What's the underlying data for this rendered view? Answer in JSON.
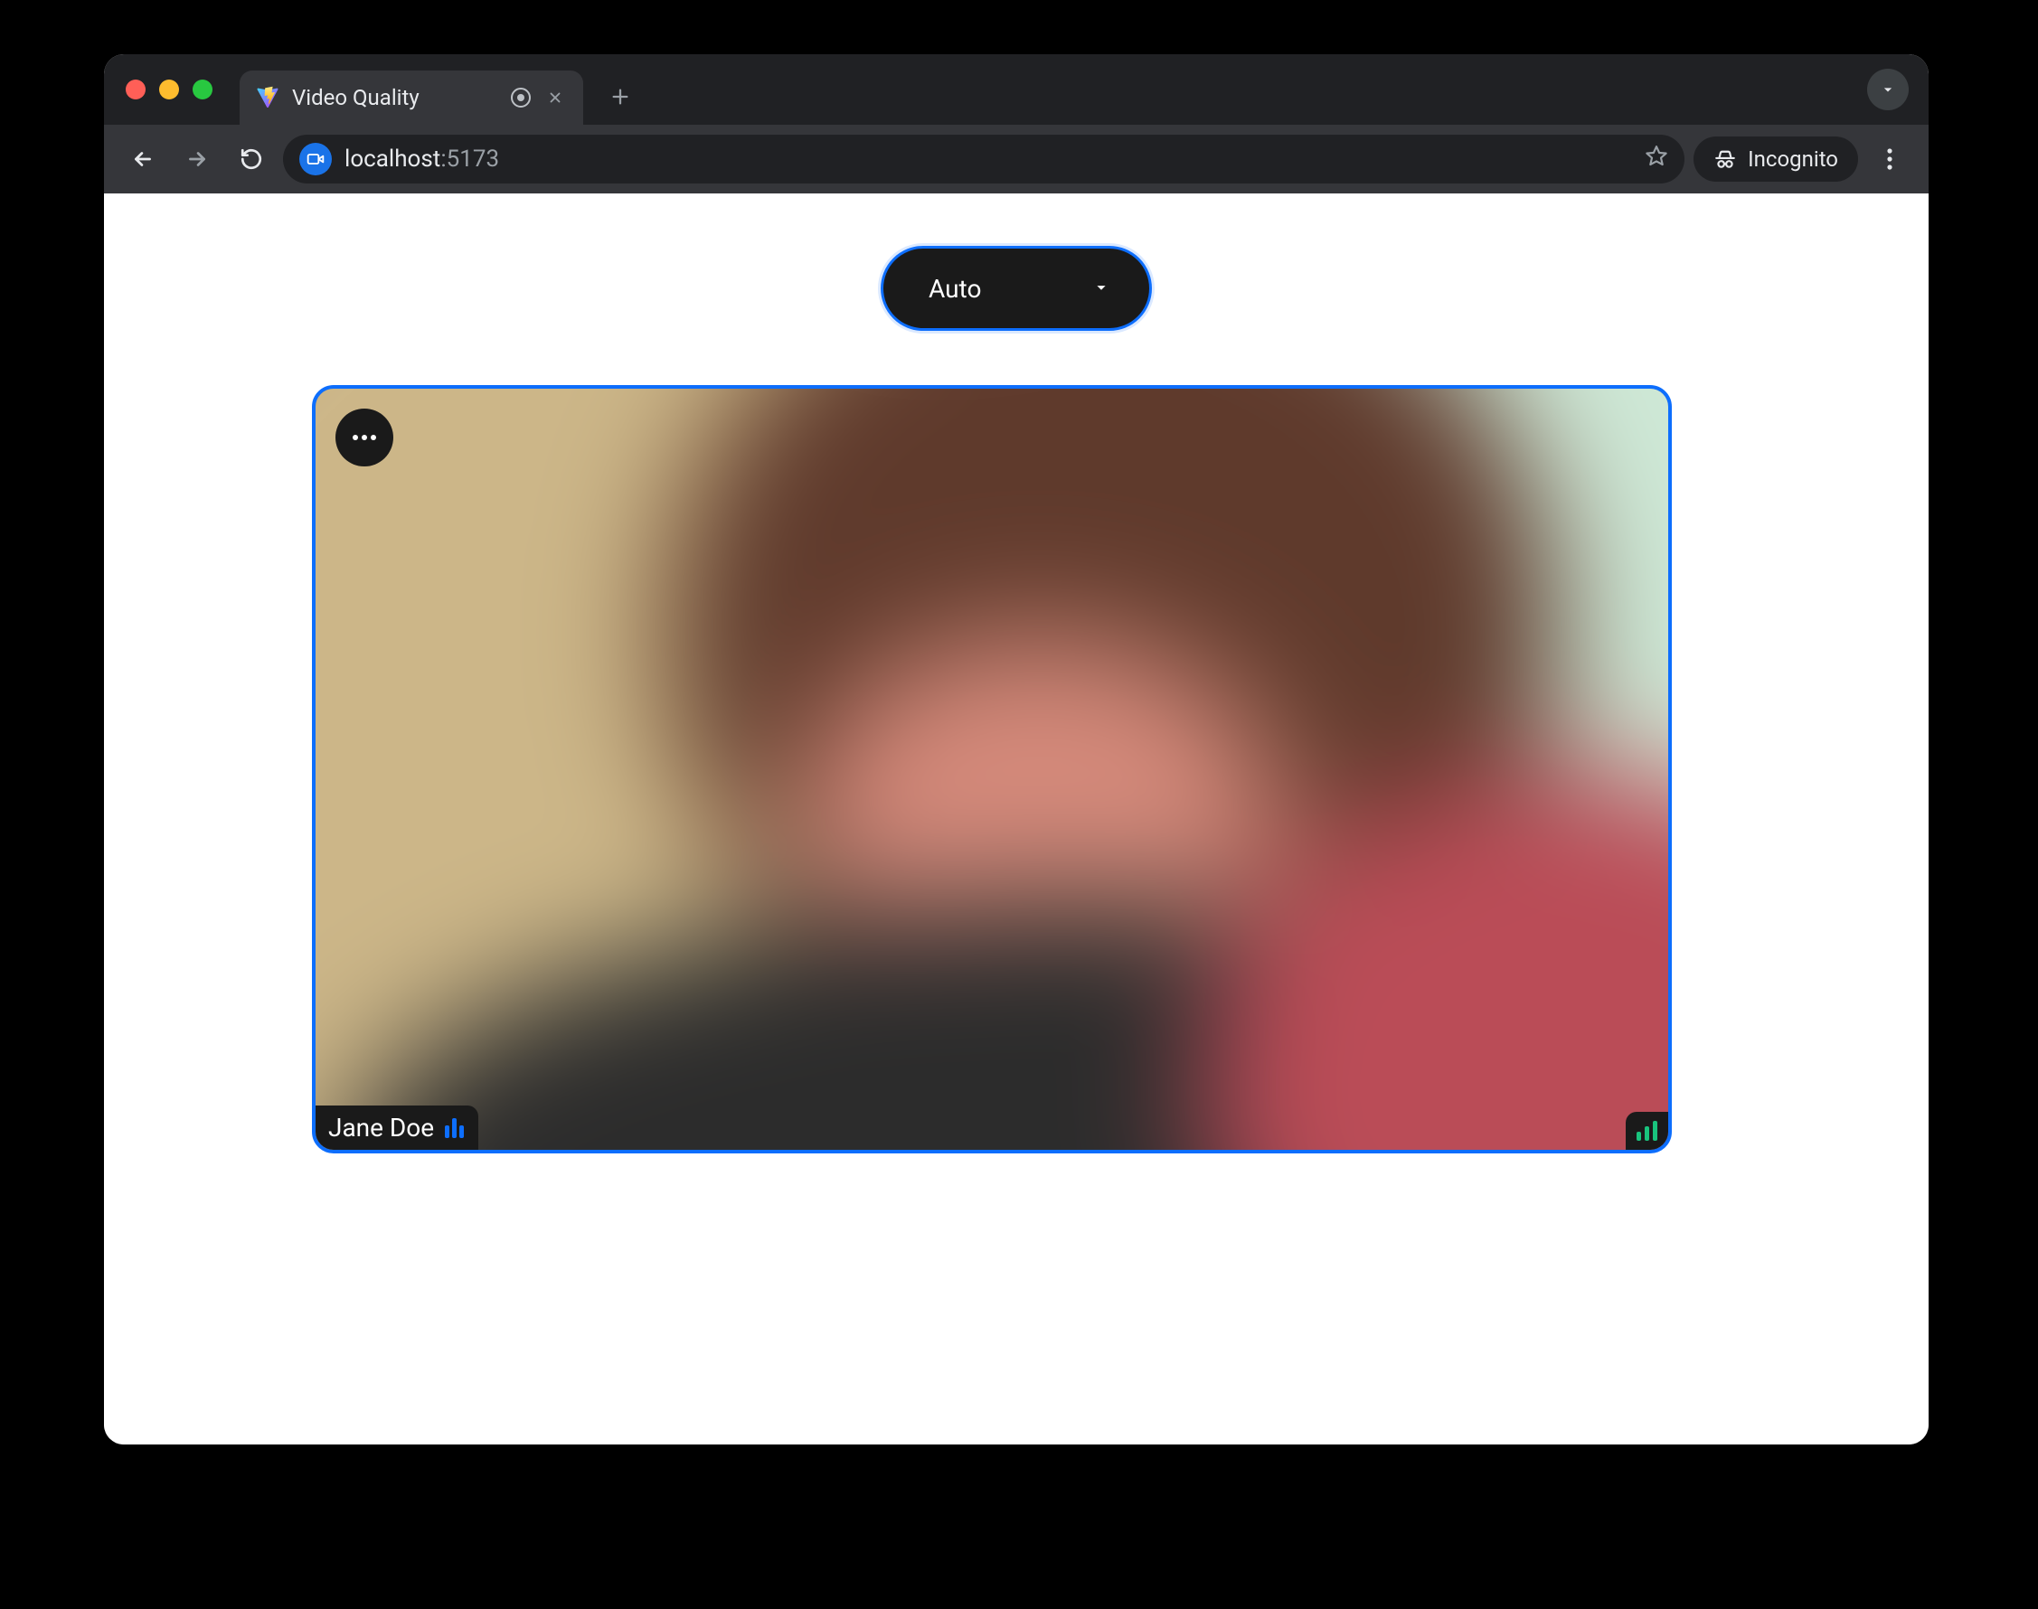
{
  "browser": {
    "tab": {
      "title": "Video Quality"
    },
    "url": {
      "host": "localhost",
      "rest": ":5173"
    },
    "incognito_label": "Incognito"
  },
  "page": {
    "quality_select": {
      "value": "Auto"
    },
    "video_tile": {
      "participant_name": "Jane Doe"
    }
  }
}
